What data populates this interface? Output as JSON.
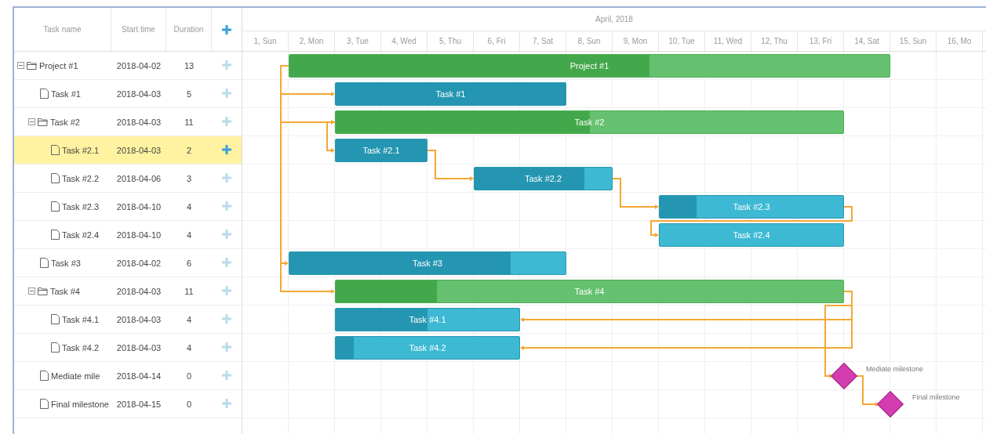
{
  "grid": {
    "columns": [
      "Task name",
      "Start time",
      "Duration"
    ]
  },
  "timeline": {
    "month": "April, 2018",
    "days": [
      "1, Sun",
      "2, Mon",
      "3, Tue",
      "4, Wed",
      "5, Thu",
      "6, Fri",
      "7, Sat",
      "8, Sun",
      "9, Mon",
      "10, Tue",
      "11, Wed",
      "12, Thu",
      "13, Fri",
      "14, Sat",
      "15, Sun",
      "16, Mo"
    ]
  },
  "tasks": [
    {
      "name": "Project #1",
      "start_time": "2018-04-02",
      "duration": "13",
      "kind": "project",
      "expanded": true,
      "selected": false,
      "bar_label": "Project #1",
      "level": 0.6,
      "children": [
        {
          "name": "Task #1",
          "start_time": "2018-04-03",
          "duration": "5",
          "kind": "task",
          "selected": false,
          "bar_label": "Task #1",
          "level": 1
        },
        {
          "name": "Task #2",
          "start_time": "2018-04-03",
          "duration": "11",
          "kind": "project",
          "expanded": true,
          "selected": false,
          "bar_label": "Task #2",
          "level": 0.5,
          "children": [
            {
              "name": "Task #2.1",
              "start_time": "2018-04-03",
              "duration": "2",
              "kind": "task",
              "selected": true,
              "bar_label": "Task #2.1",
              "level": 1
            },
            {
              "name": "Task #2.2",
              "start_time": "2018-04-06",
              "duration": "3",
              "kind": "task",
              "selected": false,
              "bar_label": "Task #2.2",
              "level": 0.8
            },
            {
              "name": "Task #2.3",
              "start_time": "2018-04-10",
              "duration": "4",
              "kind": "task",
              "selected": false,
              "bar_label": "Task #2.3",
              "level": 0.2
            },
            {
              "name": "Task #2.4",
              "start_time": "2018-04-10",
              "duration": "4",
              "kind": "task",
              "selected": false,
              "bar_label": "Task #2.4"
            }
          ]
        },
        {
          "name": "Task #3",
          "start_time": "2018-04-02",
          "duration": "6",
          "kind": "task",
          "selected": false,
          "bar_label": "Task #3",
          "level": 0.8
        },
        {
          "name": "Task #4",
          "start_time": "2018-04-03",
          "duration": "11",
          "kind": "project",
          "expanded": true,
          "selected": false,
          "bar_label": "Task #4",
          "level": 0.2,
          "children": [
            {
              "name": "Task #4.1",
              "start_time": "2018-04-03",
              "duration": "4",
              "kind": "task",
              "selected": false,
              "bar_label": "Task #4.1",
              "level": 0.5
            },
            {
              "name": "Task #4.2",
              "start_time": "2018-04-03",
              "duration": "4",
              "kind": "task",
              "selected": false,
              "bar_label": "Task #4.2",
              "level": 0.1
            }
          ]
        },
        {
          "name": "Mediate mile",
          "start_time": "2018-04-14",
          "duration": "0",
          "kind": "milestone",
          "selected": false,
          "bar_label": "Mediate milestone"
        },
        {
          "name": "Final milestone",
          "start_time": "2018-04-15",
          "duration": "0",
          "kind": "milestone",
          "selected": false,
          "bar_label": "Final milestone"
        }
      ]
    }
  ]
}
